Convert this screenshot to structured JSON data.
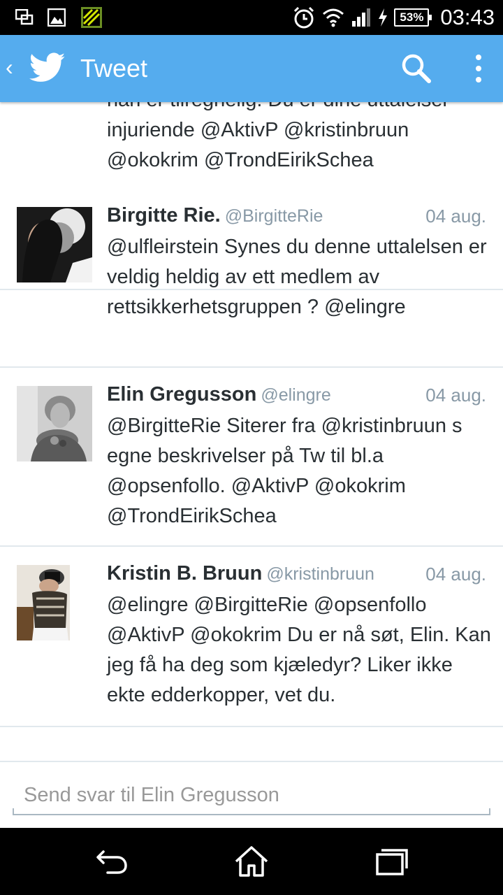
{
  "status_bar": {
    "time": "03:43",
    "battery": "53%",
    "icons": [
      "screen-mirror-icon",
      "image-icon",
      "app-notification-icon",
      "alarm-icon",
      "wifi-icon",
      "signal-icon",
      "charging-icon",
      "battery-icon"
    ]
  },
  "action_bar": {
    "title": "Tweet",
    "back_icon": "chevron-left-icon",
    "logo_icon": "twitter-bird-icon",
    "search_icon": "search-icon",
    "menu_icon": "overflow-menu-icon",
    "background": "#55acee"
  },
  "partial_tweet": {
    "text": "han er tilregnelig. Du er dine uttalelser injuriende @AktivP @kristinbruun @okokrim @TrondEirikSchea"
  },
  "tweets": [
    {
      "name": "Birgitte Rie.",
      "handle": "@BirgitteRie",
      "date": "04 aug.",
      "text": "@ulfleirstein Synes du denne uttalelsen er veldig heldig av ett medlem av rettsikkerhetsgruppen ? @elingre"
    },
    {
      "name": "Elin Gregusson",
      "handle": "@elingre",
      "date": "04 aug.",
      "text": "@BirgitteRie Siterer fra @kristinbruun s egne beskrivelser på Tw til bl.a @opsenfollo. @AktivP @okokrim @TrondEirikSchea"
    },
    {
      "name": "Kristin B. Bruun",
      "handle": "@kristinbruun",
      "date": "04 aug.",
      "text": "@elingre @BirgitteRie @opsenfollo @AktivP @okokrim Du er nå søt, Elin. Kan jeg få ha deg som kjæledyr? Liker ikke ekte edderkopper, vet du."
    }
  ],
  "reply": {
    "placeholder": "Send svar til Elin Gregusson"
  },
  "nav_bar": {
    "icons": [
      "back-icon",
      "home-icon",
      "recent-apps-icon"
    ]
  }
}
